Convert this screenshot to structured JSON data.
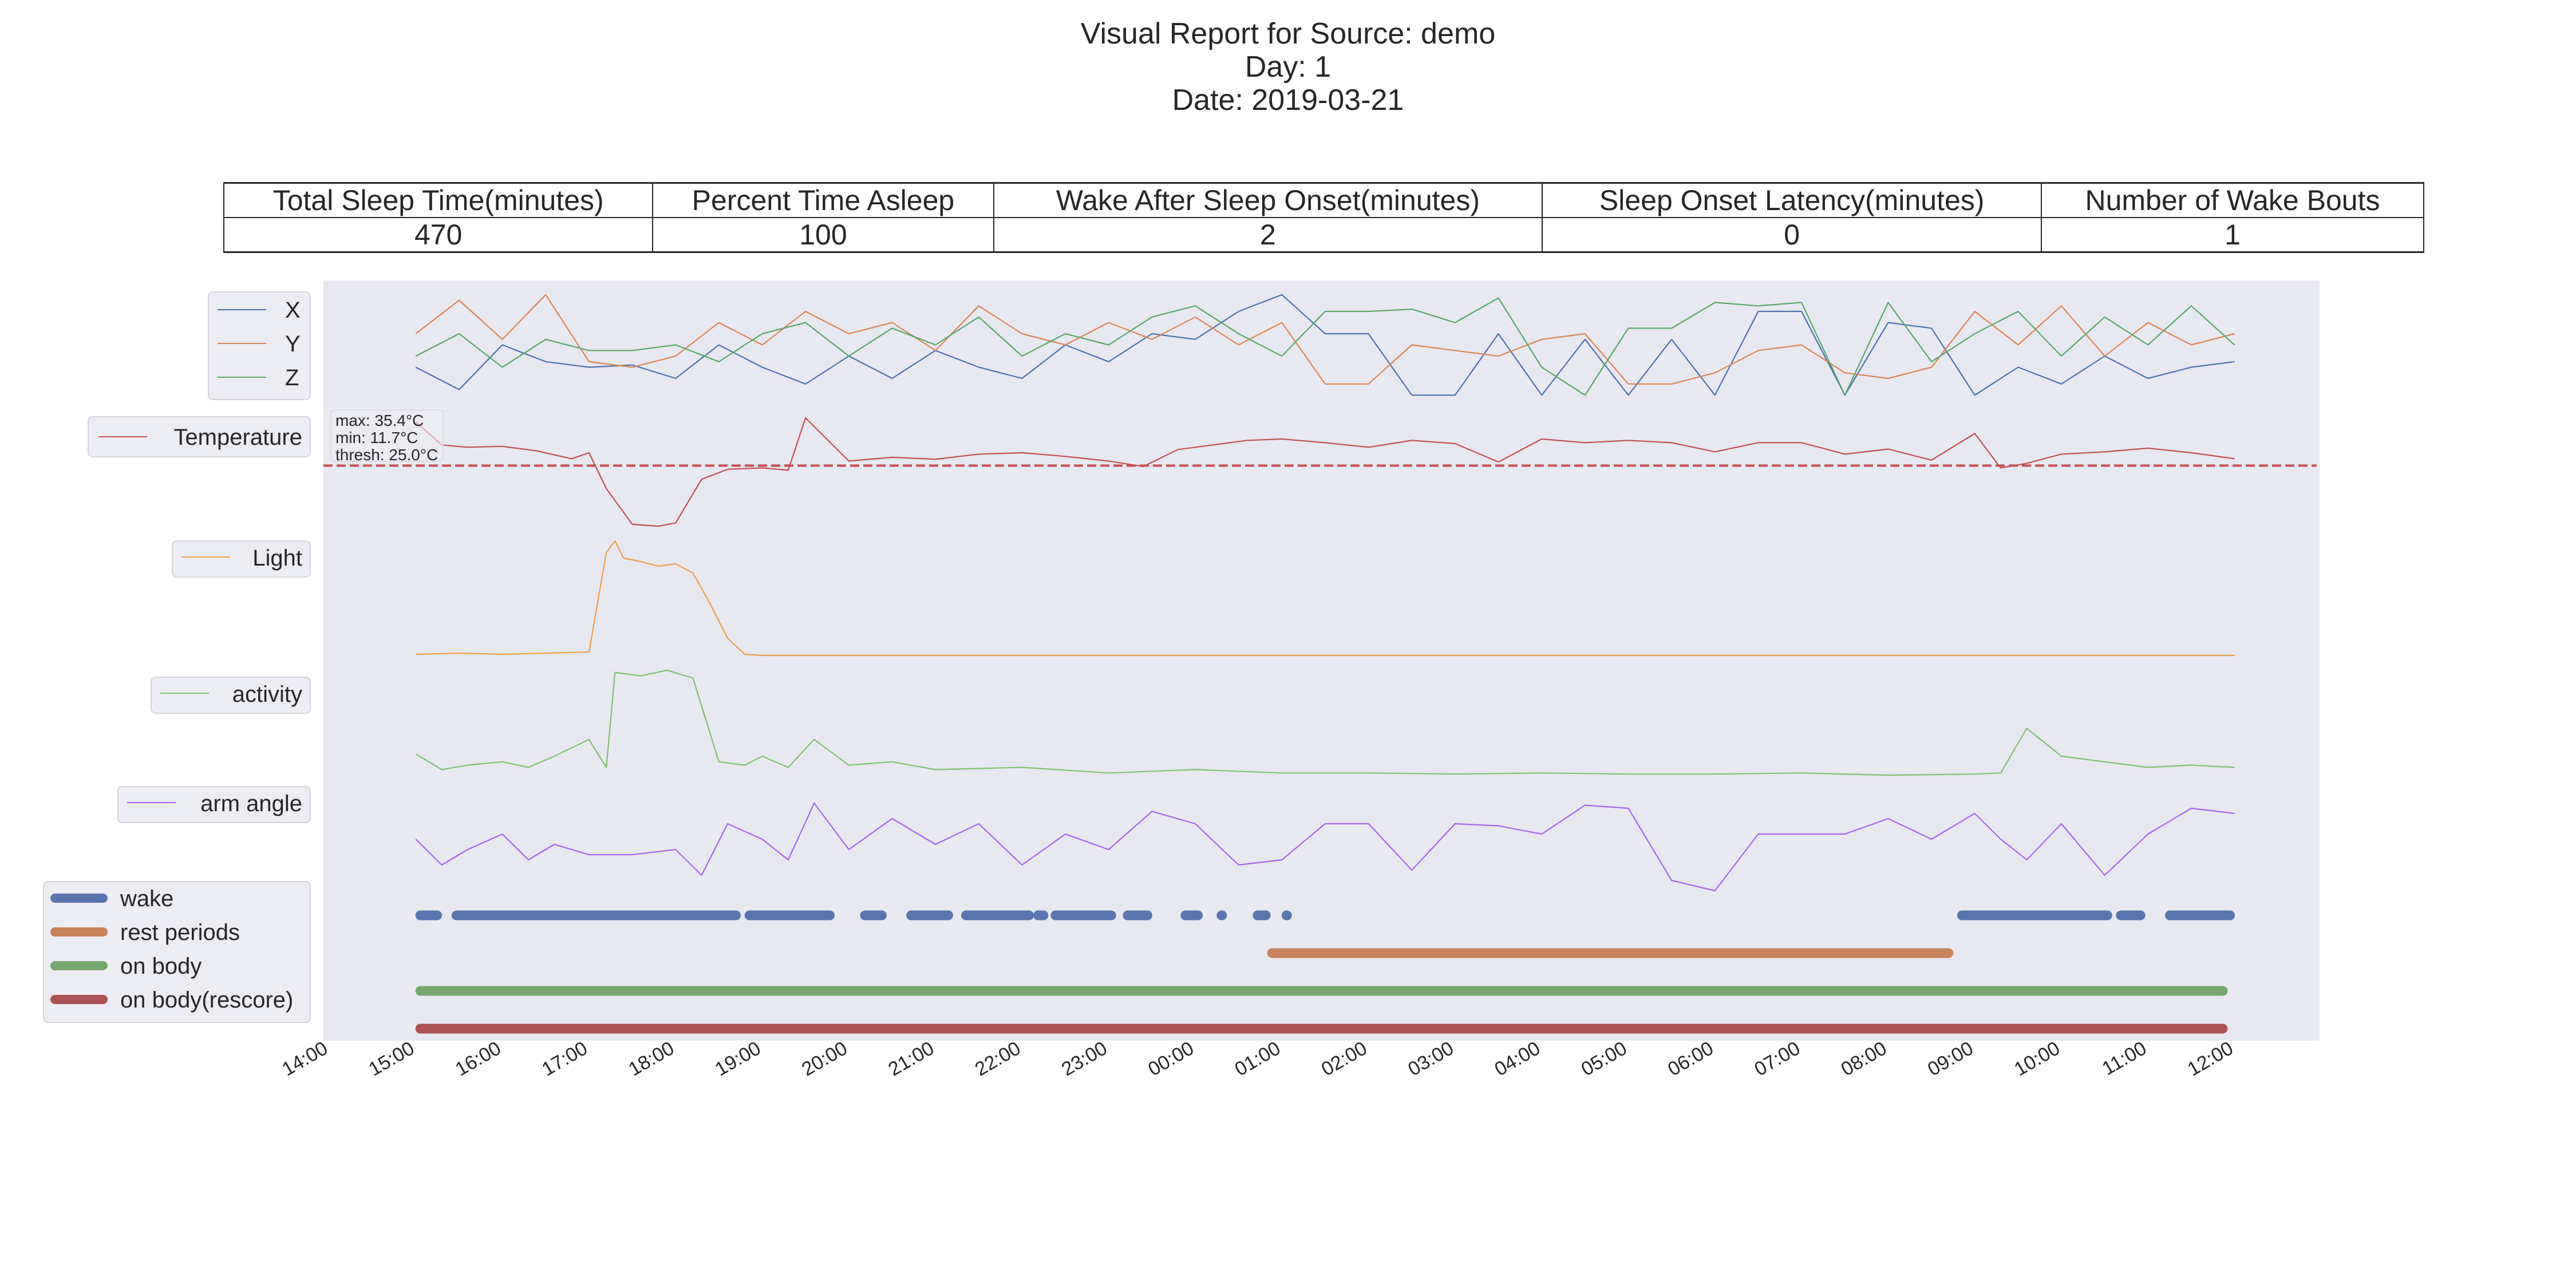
{
  "title": {
    "line1": "Visual Report for Source: demo",
    "line2": "Day: 1",
    "line3": "Date: 2019-03-21"
  },
  "stats_table": {
    "headers": [
      "Total Sleep Time(minutes)",
      "Percent Time Asleep",
      "Wake After Sleep Onset(minutes)",
      "Sleep Onset Latency(minutes)",
      "Number of Wake Bouts"
    ],
    "values": [
      "470",
      "100",
      "2",
      "0",
      "1"
    ]
  },
  "chart_data": {
    "type": "line",
    "title": "Visual Report for Source: demo",
    "xlabel": "",
    "x_range": [
      "14:00",
      "13:00"
    ],
    "x_ticks": [
      "14:00",
      "15:00",
      "16:00",
      "17:00",
      "18:00",
      "19:00",
      "20:00",
      "21:00",
      "22:00",
      "23:00",
      "00:00",
      "01:00",
      "02:00",
      "03:00",
      "04:00",
      "05:00",
      "06:00",
      "07:00",
      "08:00",
      "09:00",
      "10:00",
      "11:00",
      "12:00"
    ],
    "grid": false,
    "colors": {
      "x": "#4c72b0",
      "y": "#dd8452",
      "z": "#55a868",
      "temperature": "#c44e52",
      "light": "#f0a04b",
      "activity": "#7fc06f",
      "arm_angle": "#a366f0",
      "wake": "#5875ae",
      "rest": "#c8835a",
      "on_body": "#74a86c",
      "on_body_rescore": "#ac5154",
      "panel_bg": "#e8e8f1"
    },
    "panels": [
      {
        "name": "accelerometer",
        "legend": [
          "X",
          "Y",
          "Z"
        ],
        "series": [
          {
            "name": "X",
            "x_hours": [
              15.0,
              15.5,
              16.0,
              16.5,
              17.0,
              17.5,
              18.0,
              18.5,
              19.0,
              19.5,
              20.0,
              20.5,
              21.0,
              21.5,
              22.0,
              22.5,
              23.0,
              23.5,
              24.0,
              24.5,
              25.0,
              25.5,
              26.0,
              26.5,
              27.0,
              27.5,
              28.0,
              28.5,
              29.0,
              29.5,
              30.0,
              30.5,
              31.0,
              31.5,
              32.0,
              32.5,
              33.0,
              33.5,
              34.0,
              34.5,
              35.0,
              35.5,
              36.0
            ],
            "values": [
              0.3,
              0.1,
              0.5,
              0.35,
              0.3,
              0.32,
              0.2,
              0.5,
              0.3,
              0.15,
              0.4,
              0.2,
              0.45,
              0.3,
              0.2,
              0.5,
              0.35,
              0.6,
              0.55,
              0.8,
              0.95,
              0.6,
              0.6,
              0.05,
              0.05,
              0.6,
              0.05,
              0.55,
              0.05,
              0.55,
              0.05,
              0.8,
              0.8,
              0.05,
              0.7,
              0.65,
              0.05,
              0.3,
              0.15,
              0.4,
              0.2,
              0.3,
              0.35
            ]
          },
          {
            "name": "Y",
            "x_hours": [
              15.0,
              15.5,
              16.0,
              16.5,
              17.0,
              17.5,
              18.0,
              18.5,
              19.0,
              19.5,
              20.0,
              20.5,
              21.0,
              21.5,
              22.0,
              22.5,
              23.0,
              23.5,
              24.0,
              24.5,
              25.0,
              25.5,
              26.0,
              26.5,
              27.0,
              27.5,
              28.0,
              28.5,
              29.0,
              29.5,
              30.0,
              30.5,
              31.0,
              31.5,
              32.0,
              32.5,
              33.0,
              33.5,
              34.0,
              34.5,
              35.0,
              35.5,
              36.0
            ],
            "values": [
              0.6,
              0.9,
              0.55,
              0.95,
              0.35,
              0.3,
              0.4,
              0.7,
              0.5,
              0.8,
              0.6,
              0.7,
              0.45,
              0.85,
              0.6,
              0.5,
              0.7,
              0.55,
              0.75,
              0.5,
              0.7,
              0.15,
              0.15,
              0.5,
              0.45,
              0.4,
              0.55,
              0.6,
              0.15,
              0.15,
              0.25,
              0.45,
              0.5,
              0.25,
              0.2,
              0.3,
              0.8,
              0.5,
              0.85,
              0.4,
              0.7,
              0.5,
              0.6
            ]
          },
          {
            "name": "Z",
            "x_hours": [
              15.0,
              15.5,
              16.0,
              16.5,
              17.0,
              17.5,
              18.0,
              18.5,
              19.0,
              19.5,
              20.0,
              20.5,
              21.0,
              21.5,
              22.0,
              22.5,
              23.0,
              23.5,
              24.0,
              24.5,
              25.0,
              25.5,
              26.0,
              26.5,
              27.0,
              27.5,
              28.0,
              28.5,
              29.0,
              29.5,
              30.0,
              30.5,
              31.0,
              31.5,
              32.0,
              32.5,
              33.0,
              33.5,
              34.0,
              34.5,
              35.0,
              35.5,
              36.0
            ],
            "values": [
              0.4,
              0.6,
              0.3,
              0.55,
              0.45,
              0.45,
              0.5,
              0.35,
              0.6,
              0.7,
              0.4,
              0.65,
              0.5,
              0.75,
              0.4,
              0.6,
              0.5,
              0.75,
              0.85,
              0.6,
              0.4,
              0.8,
              0.8,
              0.82,
              0.7,
              0.92,
              0.3,
              0.05,
              0.65,
              0.65,
              0.88,
              0.85,
              0.88,
              0.05,
              0.88,
              0.35,
              0.6,
              0.8,
              0.4,
              0.75,
              0.5,
              0.85,
              0.5
            ]
          }
        ]
      },
      {
        "name": "temperature",
        "legend": [
          "Temperature"
        ],
        "annotation": {
          "max": "max: 35.4°C",
          "min": "min: 11.7°C",
          "thresh": "thresh: 25.0°C"
        },
        "threshold": 25.0,
        "y_range": [
          11.7,
          35.4
        ],
        "x_hours": [
          15.0,
          15.3,
          15.6,
          16.0,
          16.4,
          16.8,
          17.0,
          17.2,
          17.5,
          17.8,
          18.0,
          18.3,
          18.6,
          19.0,
          19.3,
          19.5,
          20.0,
          20.5,
          21.0,
          21.5,
          22.0,
          22.5,
          23.0,
          23.4,
          23.8,
          24.2,
          24.6,
          25.0,
          25.5,
          26.0,
          26.5,
          27.0,
          27.5,
          28.0,
          28.5,
          29.0,
          29.5,
          30.0,
          30.5,
          31.0,
          31.5,
          32.0,
          32.5,
          33.0,
          33.3,
          33.6,
          34.0,
          34.5,
          35.0,
          35.5,
          36.0
        ],
        "values": [
          34.5,
          29.5,
          29.0,
          29.2,
          28.2,
          26.5,
          27.8,
          20.0,
          12.2,
          11.8,
          12.5,
          22.0,
          24.2,
          24.5,
          24.0,
          35.4,
          26.0,
          26.8,
          26.4,
          27.5,
          27.8,
          27.0,
          26.0,
          24.8,
          28.5,
          29.5,
          30.5,
          30.8,
          30.0,
          29.0,
          30.5,
          29.8,
          25.8,
          30.8,
          30.0,
          30.5,
          30.0,
          28.0,
          30.0,
          30.0,
          27.5,
          28.6,
          26.2,
          32.0,
          24.5,
          25.5,
          27.5,
          28.0,
          28.8,
          27.8,
          26.5
        ]
      },
      {
        "name": "light",
        "legend": [
          "Light"
        ],
        "x_hours": [
          15.0,
          15.5,
          16.0,
          16.5,
          17.0,
          17.2,
          17.3,
          17.4,
          17.6,
          17.8,
          18.0,
          18.2,
          18.4,
          18.6,
          18.8,
          19.0,
          20.0,
          22.0,
          24.0,
          26.0,
          28.0,
          30.0,
          32.0,
          34.0,
          36.0
        ],
        "values": [
          0.01,
          0.02,
          0.01,
          0.02,
          0.03,
          0.9,
          1.0,
          0.85,
          0.82,
          0.78,
          0.8,
          0.72,
          0.45,
          0.15,
          0.01,
          0.0,
          0.0,
          0.0,
          0.0,
          0.0,
          0.0,
          0.0,
          0.0,
          0.0,
          0.0
        ]
      },
      {
        "name": "activity",
        "legend": [
          "activity"
        ],
        "x_hours": [
          15.0,
          15.3,
          15.6,
          16.0,
          16.3,
          16.6,
          17.0,
          17.2,
          17.3,
          17.6,
          17.9,
          18.2,
          18.5,
          18.8,
          19.0,
          19.3,
          19.6,
          20.0,
          20.5,
          21.0,
          22.0,
          23.0,
          24.0,
          25.0,
          26.0,
          27.0,
          28.0,
          29.0,
          30.0,
          31.0,
          32.0,
          33.0,
          33.3,
          33.6,
          34.0,
          34.5,
          35.0,
          35.5,
          36.0
        ],
        "values": [
          0.22,
          0.08,
          0.12,
          0.15,
          0.1,
          0.2,
          0.35,
          0.1,
          0.95,
          0.92,
          0.97,
          0.9,
          0.15,
          0.12,
          0.2,
          0.1,
          0.35,
          0.12,
          0.15,
          0.08,
          0.1,
          0.05,
          0.08,
          0.05,
          0.05,
          0.04,
          0.05,
          0.04,
          0.04,
          0.05,
          0.03,
          0.04,
          0.05,
          0.45,
          0.2,
          0.15,
          0.1,
          0.12,
          0.1
        ]
      },
      {
        "name": "arm_angle",
        "legend": [
          "arm angle"
        ],
        "x_hours": [
          15.0,
          15.3,
          15.6,
          16.0,
          16.3,
          16.6,
          17.0,
          17.5,
          18.0,
          18.3,
          18.6,
          19.0,
          19.3,
          19.6,
          20.0,
          20.5,
          21.0,
          21.5,
          22.0,
          22.5,
          23.0,
          23.5,
          24.0,
          24.5,
          25.0,
          25.5,
          26.0,
          26.5,
          27.0,
          27.5,
          28.0,
          28.5,
          29.0,
          29.5,
          30.0,
          30.5,
          31.0,
          31.5,
          32.0,
          32.5,
          33.0,
          33.3,
          33.6,
          34.0,
          34.5,
          35.0,
          35.5,
          36.0
        ],
        "values": [
          0.55,
          0.3,
          0.45,
          0.6,
          0.35,
          0.5,
          0.4,
          0.4,
          0.45,
          0.2,
          0.7,
          0.55,
          0.35,
          0.9,
          0.45,
          0.75,
          0.5,
          0.7,
          0.3,
          0.6,
          0.45,
          0.82,
          0.7,
          0.3,
          0.35,
          0.7,
          0.7,
          0.25,
          0.7,
          0.68,
          0.6,
          0.88,
          0.85,
          0.15,
          0.05,
          0.6,
          0.6,
          0.6,
          0.75,
          0.55,
          0.8,
          0.55,
          0.35,
          0.7,
          0.2,
          0.6,
          0.85,
          0.8
        ]
      },
      {
        "name": "sleep_bars",
        "legend": [
          "wake",
          "rest periods",
          "on body",
          "on body(rescore)"
        ],
        "wake_intervals": [
          [
            "15:00",
            "15:18"
          ],
          [
            "15:25",
            "18:45"
          ],
          [
            "18:48",
            "19:50"
          ],
          [
            "20:08",
            "20:26"
          ],
          [
            "20:40",
            "21:12"
          ],
          [
            "21:18",
            "22:08"
          ],
          [
            "22:08",
            "22:18"
          ],
          [
            "22:20",
            "23:05"
          ],
          [
            "23:10",
            "23:30"
          ],
          [
            "23:50",
            "24:05"
          ],
          [
            "24:15",
            "24:20"
          ],
          [
            "24:40",
            "24:52"
          ],
          [
            "25:00",
            "25:05"
          ]
        ],
        "wake_intervals_morning": [
          [
            "08:48",
            "10:35"
          ],
          [
            "10:38",
            "10:58"
          ],
          [
            "11:12",
            "12:00"
          ]
        ],
        "rest_periods": [
          [
            "00:50",
            "08:45"
          ]
        ],
        "on_body": [
          [
            "15:00",
            "11:55"
          ]
        ],
        "on_body_rescore": [
          [
            "15:00",
            "11:55"
          ]
        ]
      }
    ]
  }
}
